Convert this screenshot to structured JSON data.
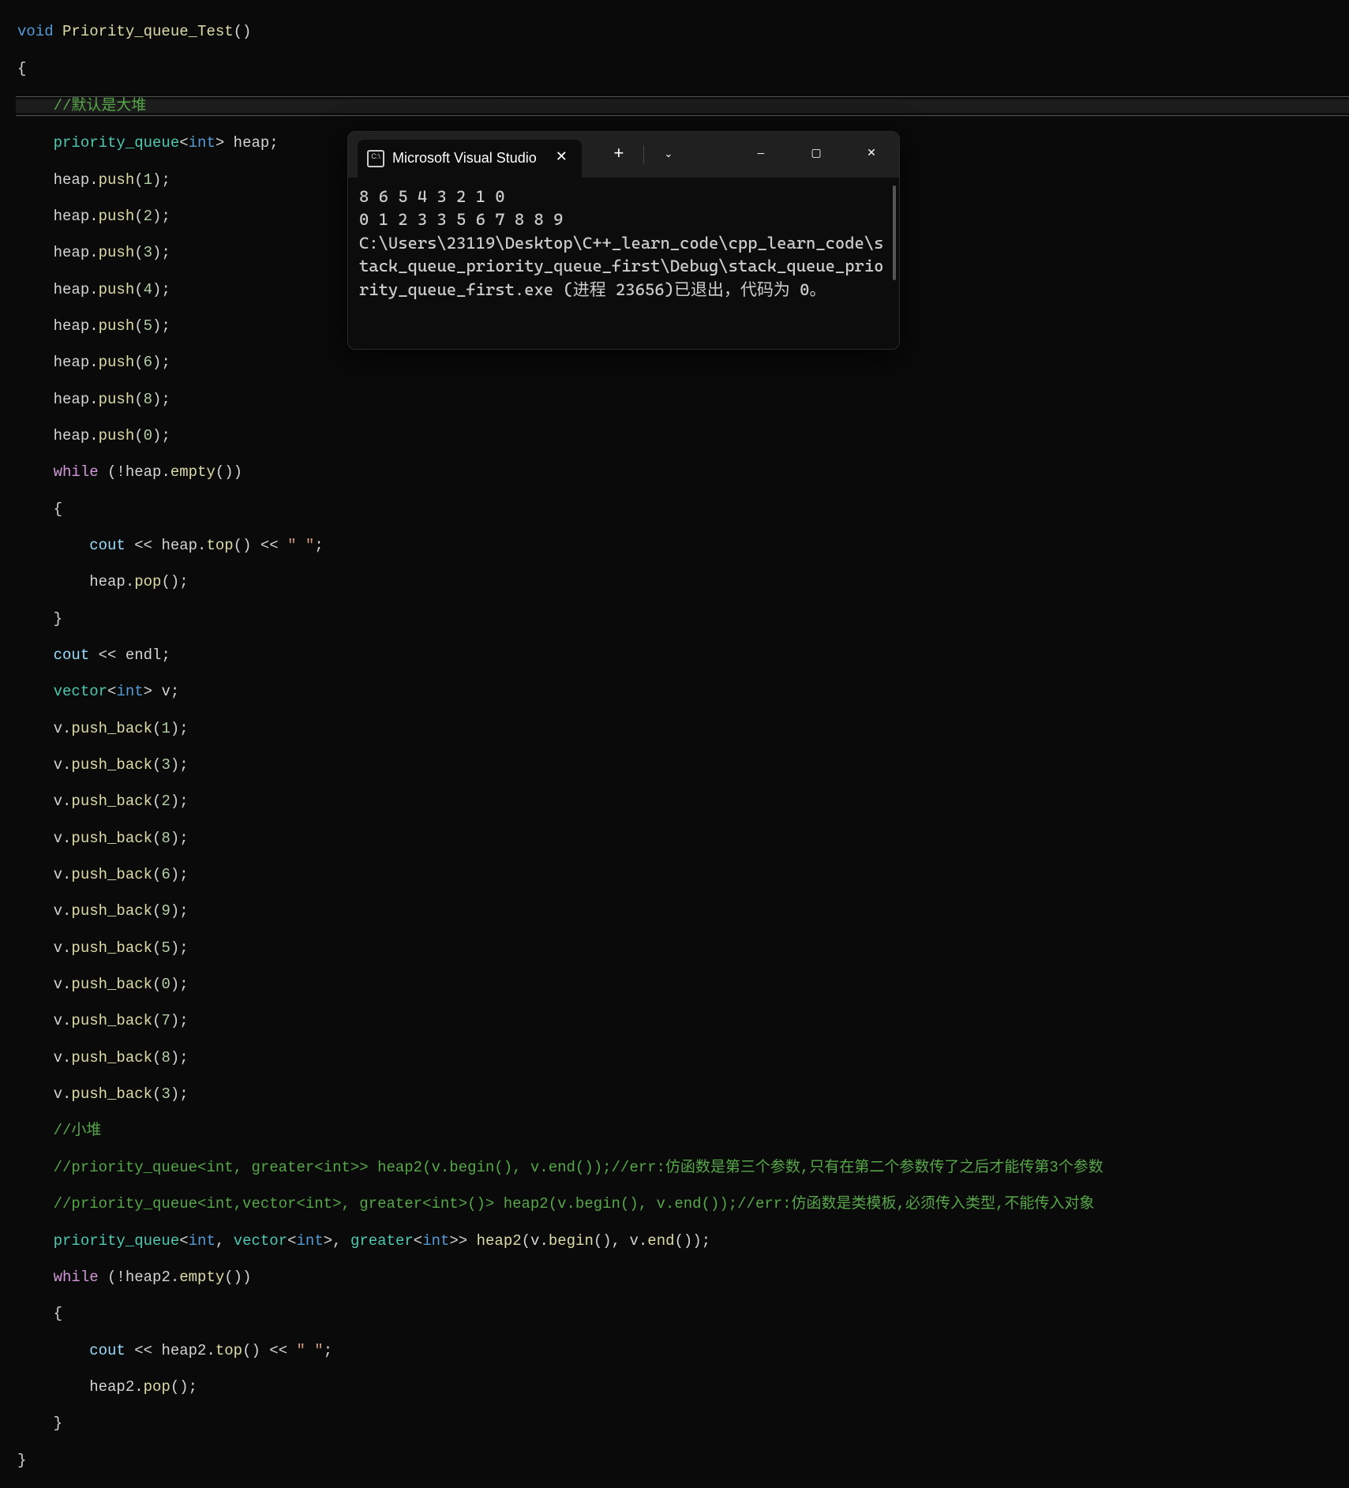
{
  "code": {
    "line1": {
      "void": "void",
      "fn": "Priority_queue_Test",
      "rest": "()"
    },
    "line2": "{",
    "line3_comment": "//默认是大堆",
    "line4": {
      "cls": "priority_queue",
      "lt": "<",
      "type": "int",
      "gt": ">",
      "var": " heap",
      "semi": ";"
    },
    "push_lines": [
      {
        "obj": "heap.",
        "fn": "push",
        "arg": "1"
      },
      {
        "obj": "heap.",
        "fn": "push",
        "arg": "2"
      },
      {
        "obj": "heap.",
        "fn": "push",
        "arg": "3"
      },
      {
        "obj": "heap.",
        "fn": "push",
        "arg": "4"
      },
      {
        "obj": "heap.",
        "fn": "push",
        "arg": "5"
      },
      {
        "obj": "heap.",
        "fn": "push",
        "arg": "6"
      },
      {
        "obj": "heap.",
        "fn": "push",
        "arg": "8"
      },
      {
        "obj": "heap.",
        "fn": "push",
        "arg": "0"
      }
    ],
    "while1": {
      "kw": "while",
      "pre": " (!heap.",
      "fn": "empty",
      "post": "())"
    },
    "brace_open": "{",
    "cout1": {
      "cout": "cout",
      "op1": " << ",
      "obj": "heap.",
      "fn": "top",
      "paren": "()",
      "op2": " << ",
      "str": "\" \"",
      "semi": ";"
    },
    "pop1": {
      "obj": "heap.",
      "fn": "pop",
      "paren": "();"
    },
    "brace_close": "}",
    "cout_endl": {
      "cout": "cout",
      "op": " << ",
      "endl": "endl",
      "semi": ";"
    },
    "vector_decl": {
      "cls": "vector",
      "lt": "<",
      "type": "int",
      "gt": ">",
      "var": " v",
      "semi": ";"
    },
    "pushback_lines": [
      {
        "obj": "v.",
        "fn": "push_back",
        "arg": "1"
      },
      {
        "obj": "v.",
        "fn": "push_back",
        "arg": "3"
      },
      {
        "obj": "v.",
        "fn": "push_back",
        "arg": "2"
      },
      {
        "obj": "v.",
        "fn": "push_back",
        "arg": "8"
      },
      {
        "obj": "v.",
        "fn": "push_back",
        "arg": "6"
      },
      {
        "obj": "v.",
        "fn": "push_back",
        "arg": "9"
      },
      {
        "obj": "v.",
        "fn": "push_back",
        "arg": "5"
      },
      {
        "obj": "v.",
        "fn": "push_back",
        "arg": "0"
      },
      {
        "obj": "v.",
        "fn": "push_back",
        "arg": "7"
      },
      {
        "obj": "v.",
        "fn": "push_back",
        "arg": "8"
      },
      {
        "obj": "v.",
        "fn": "push_back",
        "arg": "3"
      }
    ],
    "comment_small": "//小堆",
    "comment_err1": "//priority_queue<int, greater<int>> heap2(v.begin(), v.end());//err:仿函数是第三个参数,只有在第二个参数传了之后才能传第3个参数",
    "comment_err2": "//priority_queue<int,vector<int>, greater<int>()> heap2(v.begin(), v.end());//err:仿函数是类模板,必须传入类型,不能传入对象",
    "pq2": {
      "cls1": "priority_queue",
      "lt1": "<",
      "t1": "int",
      "c1": ", ",
      "cls2": "vector",
      "lt2": "<",
      "t2": "int",
      "gt2": ">",
      "c2": ", ",
      "cls3": "greater",
      "lt3": "<",
      "t3": "int",
      "gt3": ">>",
      "sp": " ",
      "fn": "heap2",
      "open": "(v.",
      "fn2": "begin",
      "p2": "(), v.",
      "fn3": "end",
      "p3": "());"
    },
    "while2": {
      "kw": "while",
      "pre": " (!heap2.",
      "fn": "empty",
      "post": "())"
    },
    "cout2": {
      "cout": "cout",
      "op1": " << ",
      "obj": "heap2.",
      "fn": "top",
      "paren": "()",
      "op2": " << ",
      "str": "\" \"",
      "semi": ";"
    },
    "pop2": {
      "obj": "heap2.",
      "fn": "pop",
      "paren": "();"
    },
    "final_brace": "}"
  },
  "terminal": {
    "tab_title": "Microsoft Visual Studio",
    "tab_icon": "C:\\",
    "output_line1": "8 6 5 4 3 2 1 0",
    "output_line2": "0 1 2 3 3 5 6 7 8 8 9",
    "output_line3": "C:\\Users\\23119\\Desktop\\C++_learn_code\\cpp_learn_code\\stack_queue_priority_queue_first\\Debug\\stack_queue_priority_queue_first.exe (进程 23656)已退出，代码为 0。"
  }
}
